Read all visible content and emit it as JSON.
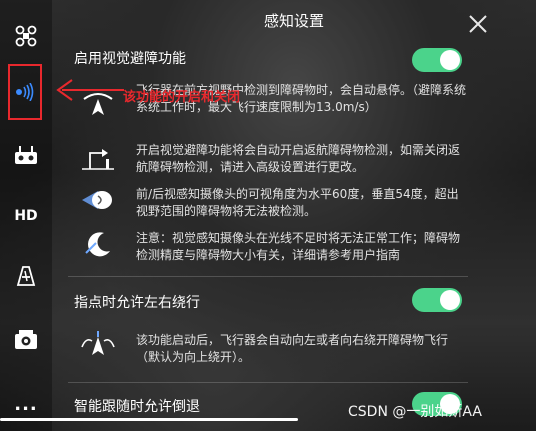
{
  "header": {
    "title": "感知设置",
    "close_icon": "close-icon"
  },
  "sidebar": {
    "items": [
      {
        "icon": "drone-icon",
        "label": ""
      },
      {
        "icon": "signal-icon",
        "label": ""
      },
      {
        "icon": "remote-controller-icon",
        "label": ""
      },
      {
        "icon": "hd-icon",
        "label": "HD"
      },
      {
        "icon": "battery-icon",
        "label": ""
      },
      {
        "icon": "camera-icon",
        "label": ""
      },
      {
        "icon": "more-icon",
        "label": "..."
      }
    ]
  },
  "annotation": {
    "text": "该功能的开启和关闭"
  },
  "settings": [
    {
      "title": "启用视觉避障功能",
      "enabled": true,
      "descriptions": [
        {
          "icon": "obstacle-icon",
          "text": "飞行器在前方视野中检测到障碍物时，会自动悬停。（避障系统系统工作时，最大飞行速度限制为13.0m/s）"
        },
        {
          "icon": "return-home-icon",
          "text": "开启视觉避障功能将会自动开启返航障碍物检测，如需关闭返航障碍物检测，请进入高级设置进行更改。"
        },
        {
          "icon": "vision-sensor-icon",
          "text": "前/后视感知摄像头的可视角度为水平60度，垂直54度，超出视野范围的障碍物将无法被检测。"
        },
        {
          "icon": "night-icon",
          "text": "注意：视觉感知摄像头在光线不足时将无法正常工作；障碍物检测精度与障碍物大小有关，详细请参考用户指南"
        }
      ]
    },
    {
      "title": "指点时允许左右绕行",
      "enabled": true,
      "descriptions": [
        {
          "icon": "bypass-icon",
          "text": "该功能启动后，飞行器会自动向左或者向右绕开障碍物飞行（默认为向上绕开）。"
        }
      ]
    },
    {
      "title": "智能跟随时允许倒退",
      "enabled": true,
      "descriptions": []
    }
  ],
  "watermark": "CSDN @一别如斯AA",
  "colors": {
    "toggle_on": "#4bd38b",
    "annotation_red": "#e8282d"
  }
}
